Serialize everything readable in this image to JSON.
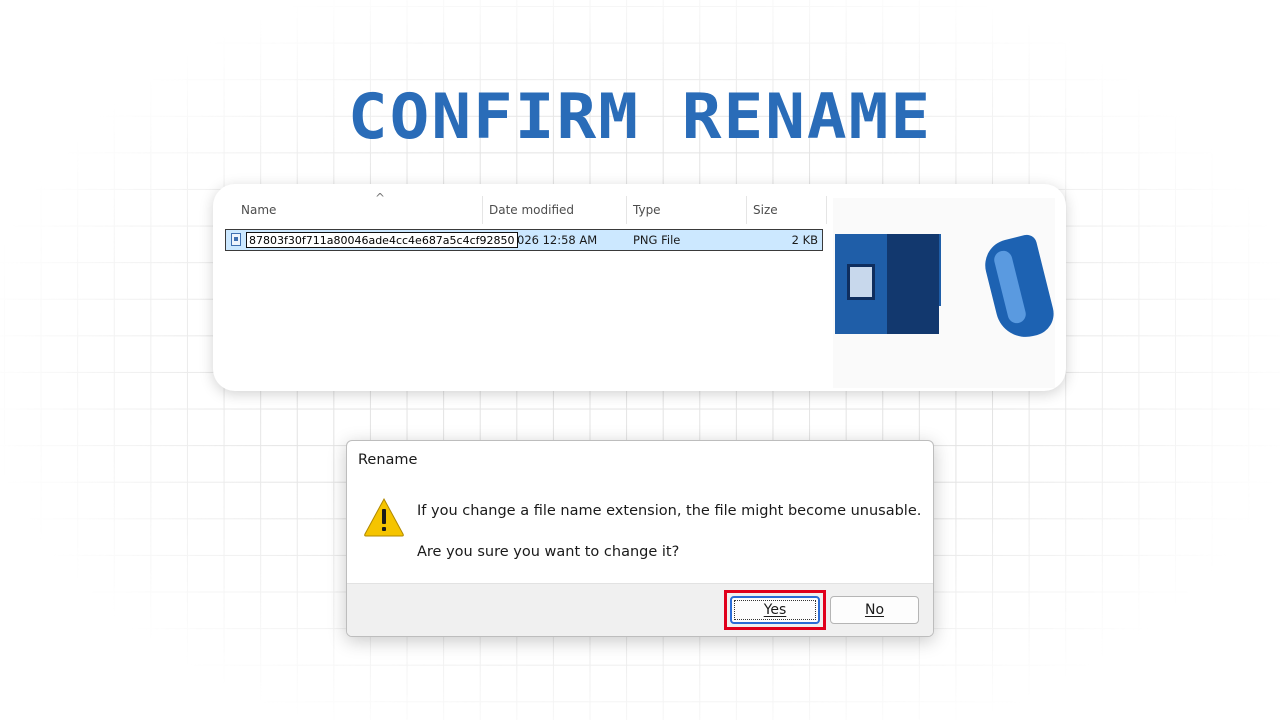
{
  "heading": "CONFIRM RENAME",
  "explorer": {
    "columns": {
      "name": "Name",
      "date": "Date modified",
      "type": "Type",
      "size": "Size"
    },
    "file": {
      "name_edit_value": "87803f30f711a80046ade4cc4e687a5c4cf92850",
      "date_modified": "026 12:58 AM",
      "type": "PNG File",
      "size": "2 KB"
    }
  },
  "dialog": {
    "title": "Rename",
    "message_line1": "If you change a file name extension, the file might become unusable.",
    "message_line2": "Are you sure you want to change it?",
    "yes_label": "Yes",
    "no_label": "No"
  },
  "colors": {
    "heading": "#2a6cb8",
    "selection": "#cce8ff",
    "highlight": "#e0001b",
    "warning": "#f5c400"
  }
}
